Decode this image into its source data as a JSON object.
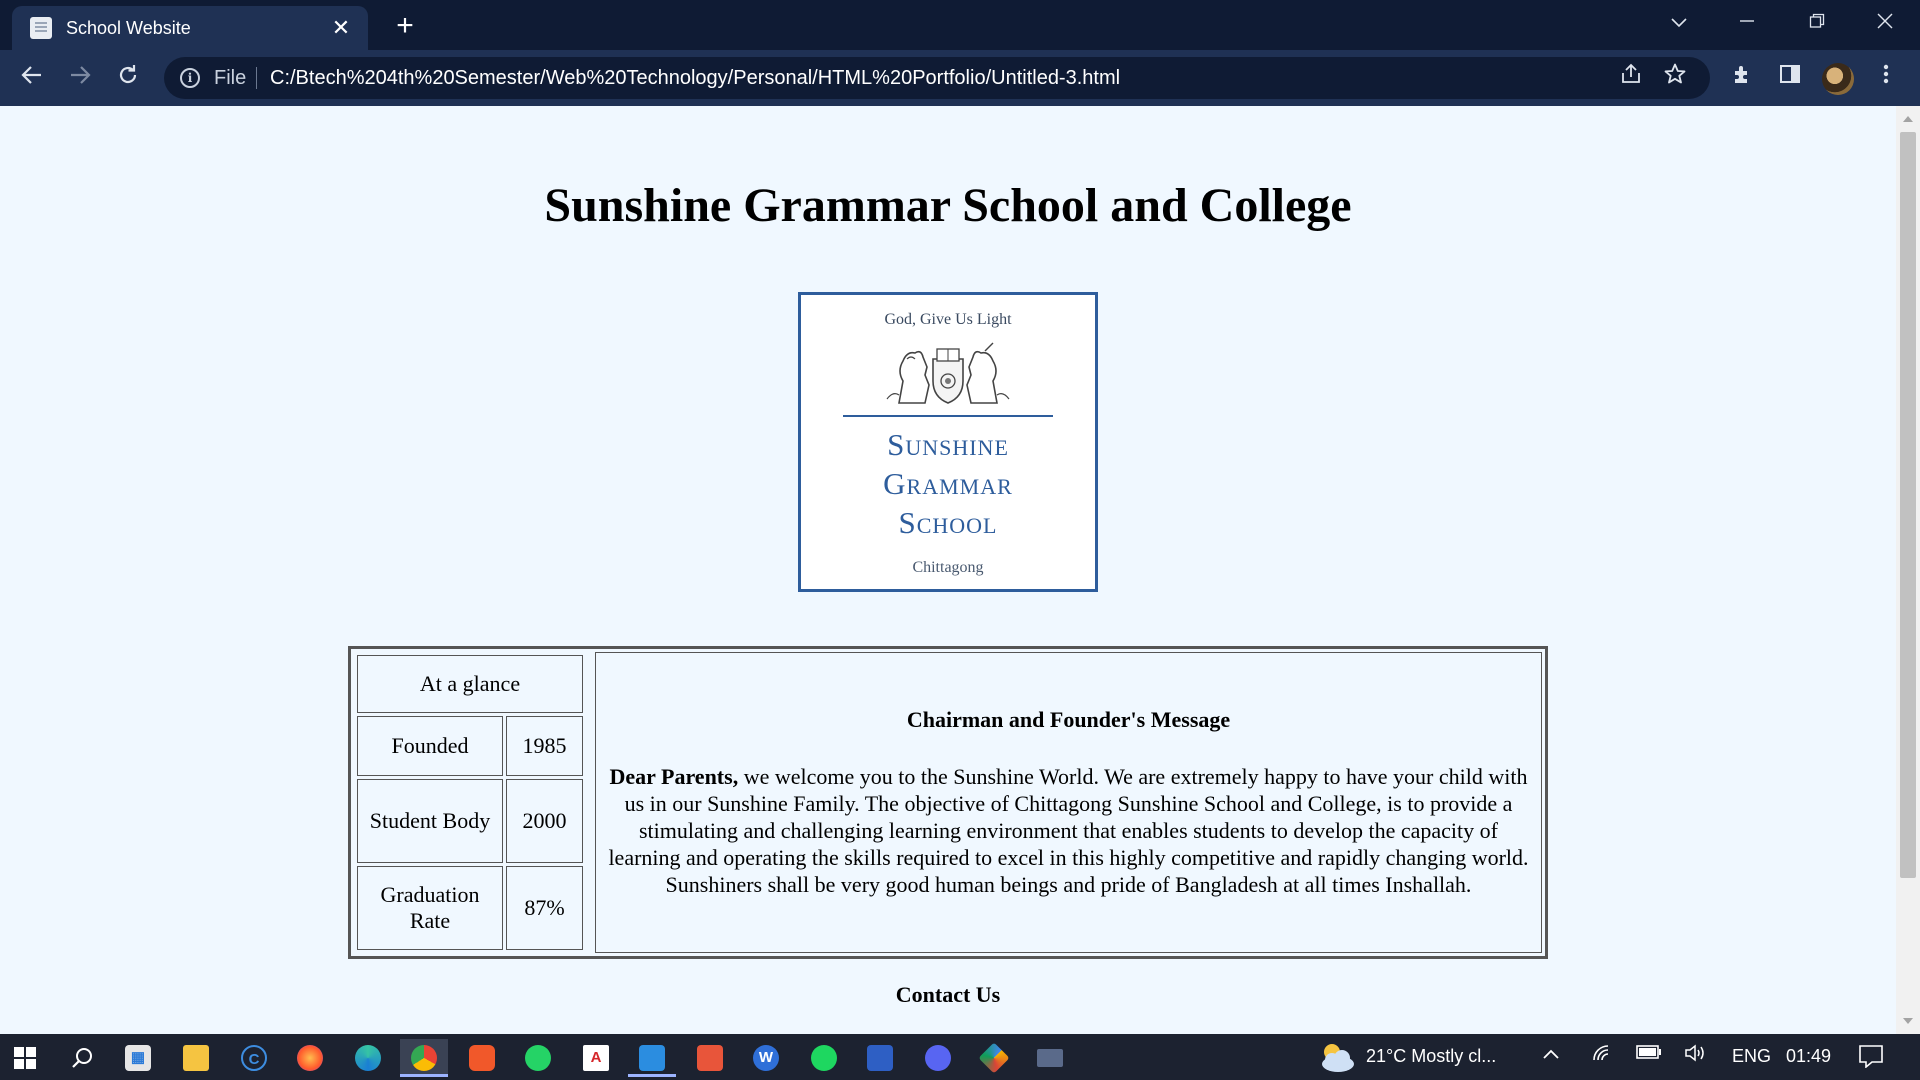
{
  "browser": {
    "tab_title": "School Website",
    "tab_close": "✕",
    "new_tab": "+",
    "file_label": "File",
    "url": "C:/Btech%204th%20Semester/Web%20Technology/Personal/HTML%20Portfolio/Untitled-3.html"
  },
  "page": {
    "title": "Sunshine Grammar School and College",
    "logo": {
      "motto": "God, Give Us Light",
      "name_lines": [
        "Sunshine",
        "Grammar",
        "School"
      ],
      "city": "Chittagong"
    },
    "glance": {
      "header": "At a glance",
      "rows": [
        {
          "label": "Founded",
          "value": "1985"
        },
        {
          "label": "Student Body",
          "value": "2000"
        },
        {
          "label": "Graduation Rate",
          "value": "87%"
        }
      ]
    },
    "message": {
      "heading": "Chairman and Founder's Message",
      "salutation": "Dear Parents,",
      "body": " we welcome you to the Sunshine World. We are extremely happy to have your child with us in our Sunshine Family. The objective of Chittagong Sunshine School and College, is to provide a stimulating and challenging learning environment that enables students to develop the capacity of learning and operating the skills required to excel in this highly competitive and rapidly changing world. Sunshiners shall be very good human beings and pride of Bangladesh at all times Inshallah."
    },
    "contact_heading": "Contact Us"
  },
  "taskbar": {
    "weather": "21°C  Mostly cl...",
    "language": "ENG",
    "time": "01:49",
    "apps": [
      "search-icon",
      "microsoft-store-icon",
      "file-explorer-icon",
      "ccleaner-icon",
      "firefox-icon",
      "edge-icon",
      "chrome-icon",
      "brave-icon",
      "whatsapp-icon",
      "acrobat-icon",
      "vscode-icon",
      "git-icon",
      "wps-icon",
      "spotify-icon",
      "app-icon",
      "discord-icon",
      "sourcetree-icon",
      "window-icon"
    ]
  },
  "colors": {
    "page_background": "#f0f8ff",
    "browser_frame": "#1f3154",
    "logo_blue": "#2e5d9c"
  }
}
